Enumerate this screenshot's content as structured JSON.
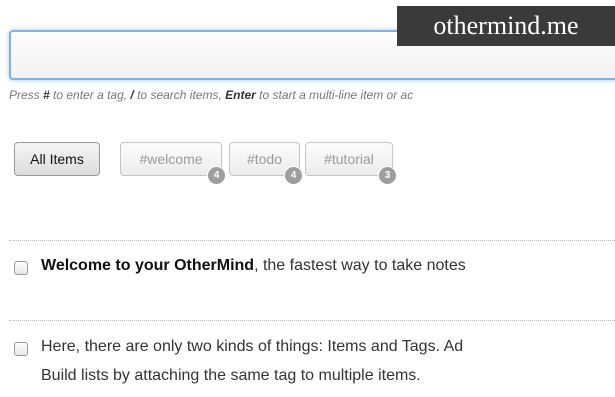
{
  "watermark": "othermind.me",
  "input": {
    "value": "",
    "placeholder": ""
  },
  "hint": {
    "p1": "Press ",
    "k1": "#",
    "p2": " to enter a tag, ",
    "k2": "/",
    "p3": " to search items, ",
    "k3": "Enter",
    "p4": " to start a multi-line item or ac"
  },
  "tag_bar": {
    "all_label": "All Items",
    "tags": [
      {
        "label": "#welcome",
        "count": "4"
      },
      {
        "label": "#todo",
        "count": "4"
      },
      {
        "label": "#tutorial",
        "count": "3"
      }
    ]
  },
  "items": [
    {
      "bold": "Welcome to your OtherMind",
      "rest": ", the fastest way to take notes"
    },
    {
      "line1": "Here, there are only two kinds of things: Items and Tags. Ad",
      "line2": "Build lists by attaching the same tag to multiple items."
    }
  ]
}
